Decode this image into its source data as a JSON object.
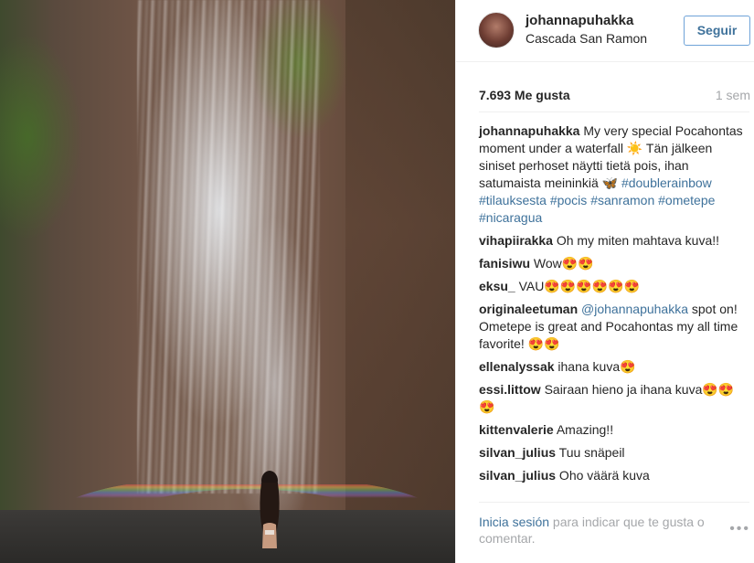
{
  "header": {
    "username": "johannapuhakka",
    "location": "Cascada San Ramon",
    "follow_label": "Seguir"
  },
  "stats": {
    "likes": "7.693 Me gusta",
    "age": "1 sem"
  },
  "caption": {
    "user": "johannapuhakka",
    "text": " My very special Pocahontas moment under a waterfall ☀️ Tän jälkeen siniset perhoset näytti tietä pois, ihan satumaista meininkiä 🦋 ",
    "hashtags": [
      "#doublerainbow",
      "#tilauksesta",
      "#pocis",
      "#sanramon",
      "#ometepe",
      "#nicaragua"
    ]
  },
  "comments": [
    {
      "user": "vihapiirakka",
      "text": " Oh my miten mahtava kuva!!"
    },
    {
      "user": "fanisiwu",
      "text": " Wow😍😍"
    },
    {
      "user": "eksu_",
      "text": " VAU😍😍😍😍😍😍"
    },
    {
      "user": "originaleetuman",
      "mention": " @johannapuhakka",
      "text": " spot on! Ometepe is great and Pocahontas my all time favorite! 😍😍"
    },
    {
      "user": "ellenalyssak",
      "text": " ihana kuva😍"
    },
    {
      "user": "essi.littow",
      "text": " Sairaan hieno ja ihana kuva😍😍😍"
    },
    {
      "user": "kittenvalerie",
      "text": " Amazing!!"
    },
    {
      "user": "silvan_julius",
      "text": " Tuu snäpeil"
    },
    {
      "user": "silvan_julius",
      "text": " Oho väärä kuva"
    }
  ],
  "footer": {
    "login_link": "Inicia sesión",
    "login_rest": " para indicar que te gusta o comentar.",
    "more": "•••"
  },
  "icons": {
    "more": "ellipsis-icon"
  }
}
